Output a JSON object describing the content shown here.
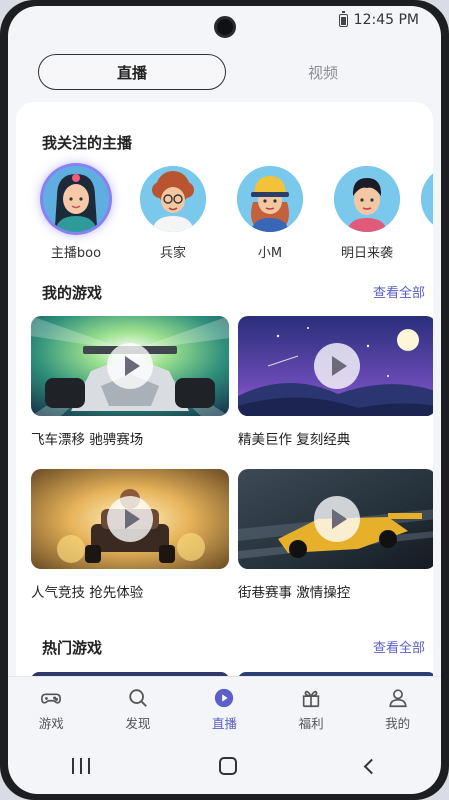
{
  "status_bar": {
    "time": "12:45 PM"
  },
  "top_tabs": [
    {
      "label": "直播",
      "active": true
    },
    {
      "label": "视频",
      "active": false
    }
  ],
  "followed_anchors": {
    "title": "我关注的主播",
    "items": [
      {
        "name": "主播boo",
        "selected": true
      },
      {
        "name": "兵家"
      },
      {
        "name": "小M"
      },
      {
        "name": "明日来袭"
      }
    ]
  },
  "my_games": {
    "title": "我的游戏",
    "more_label": "查看全部",
    "items": [
      {
        "title": "飞车漂移 驰骋赛场"
      },
      {
        "title": "精美巨作 复刻经典"
      },
      {
        "title": "人气竞技 抢先体验"
      },
      {
        "title": "街巷赛事 激情操控"
      }
    ]
  },
  "hot_games": {
    "title": "热门游戏",
    "more_label": "查看全部"
  },
  "bottom_nav": [
    {
      "label": "游戏",
      "icon": "gamepad-icon"
    },
    {
      "label": "发现",
      "icon": "search-icon"
    },
    {
      "label": "直播",
      "icon": "play-circle-icon",
      "active": true
    },
    {
      "label": "福利",
      "icon": "gift-icon"
    },
    {
      "label": "我的",
      "icon": "user-icon"
    }
  ],
  "colors": {
    "accent": "#5b5fc7",
    "selected_ring": "#8b7ff5"
  }
}
